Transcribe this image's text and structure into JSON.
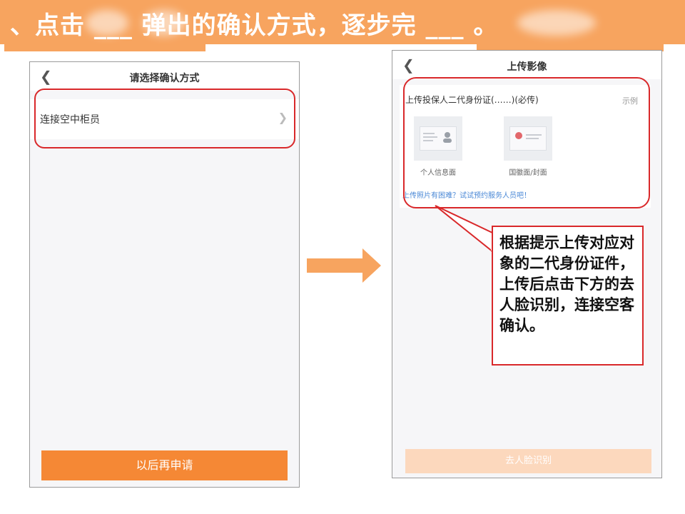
{
  "banner": {
    "title": "、点击 ___ 弹出的确认方式，逐步完 ___ 。"
  },
  "left_screen": {
    "nav_title": "请选择确认方式",
    "option_label": "连接空中柜员",
    "button_label": "以后再申请"
  },
  "right_screen": {
    "nav_title": "上传影像",
    "upload_title": "上传投保人二代身份证(……)(必传)",
    "example_label": "示例",
    "thumb_front_label": "个人信息面",
    "thumb_back_label": "国徽面/封面",
    "help_link": "上传照片有困难？试试预约服务人员吧！",
    "button_label": "去人脸识别"
  },
  "callout": {
    "text": "根据提示上传对应对象的二代身份证件，上传后点击下方的去人脸识别，连接空客确认。"
  },
  "colors": {
    "banner": "#f7a45f",
    "primary_button": "#f58835",
    "highlight": "#d9282a",
    "link": "#4a88d6"
  }
}
